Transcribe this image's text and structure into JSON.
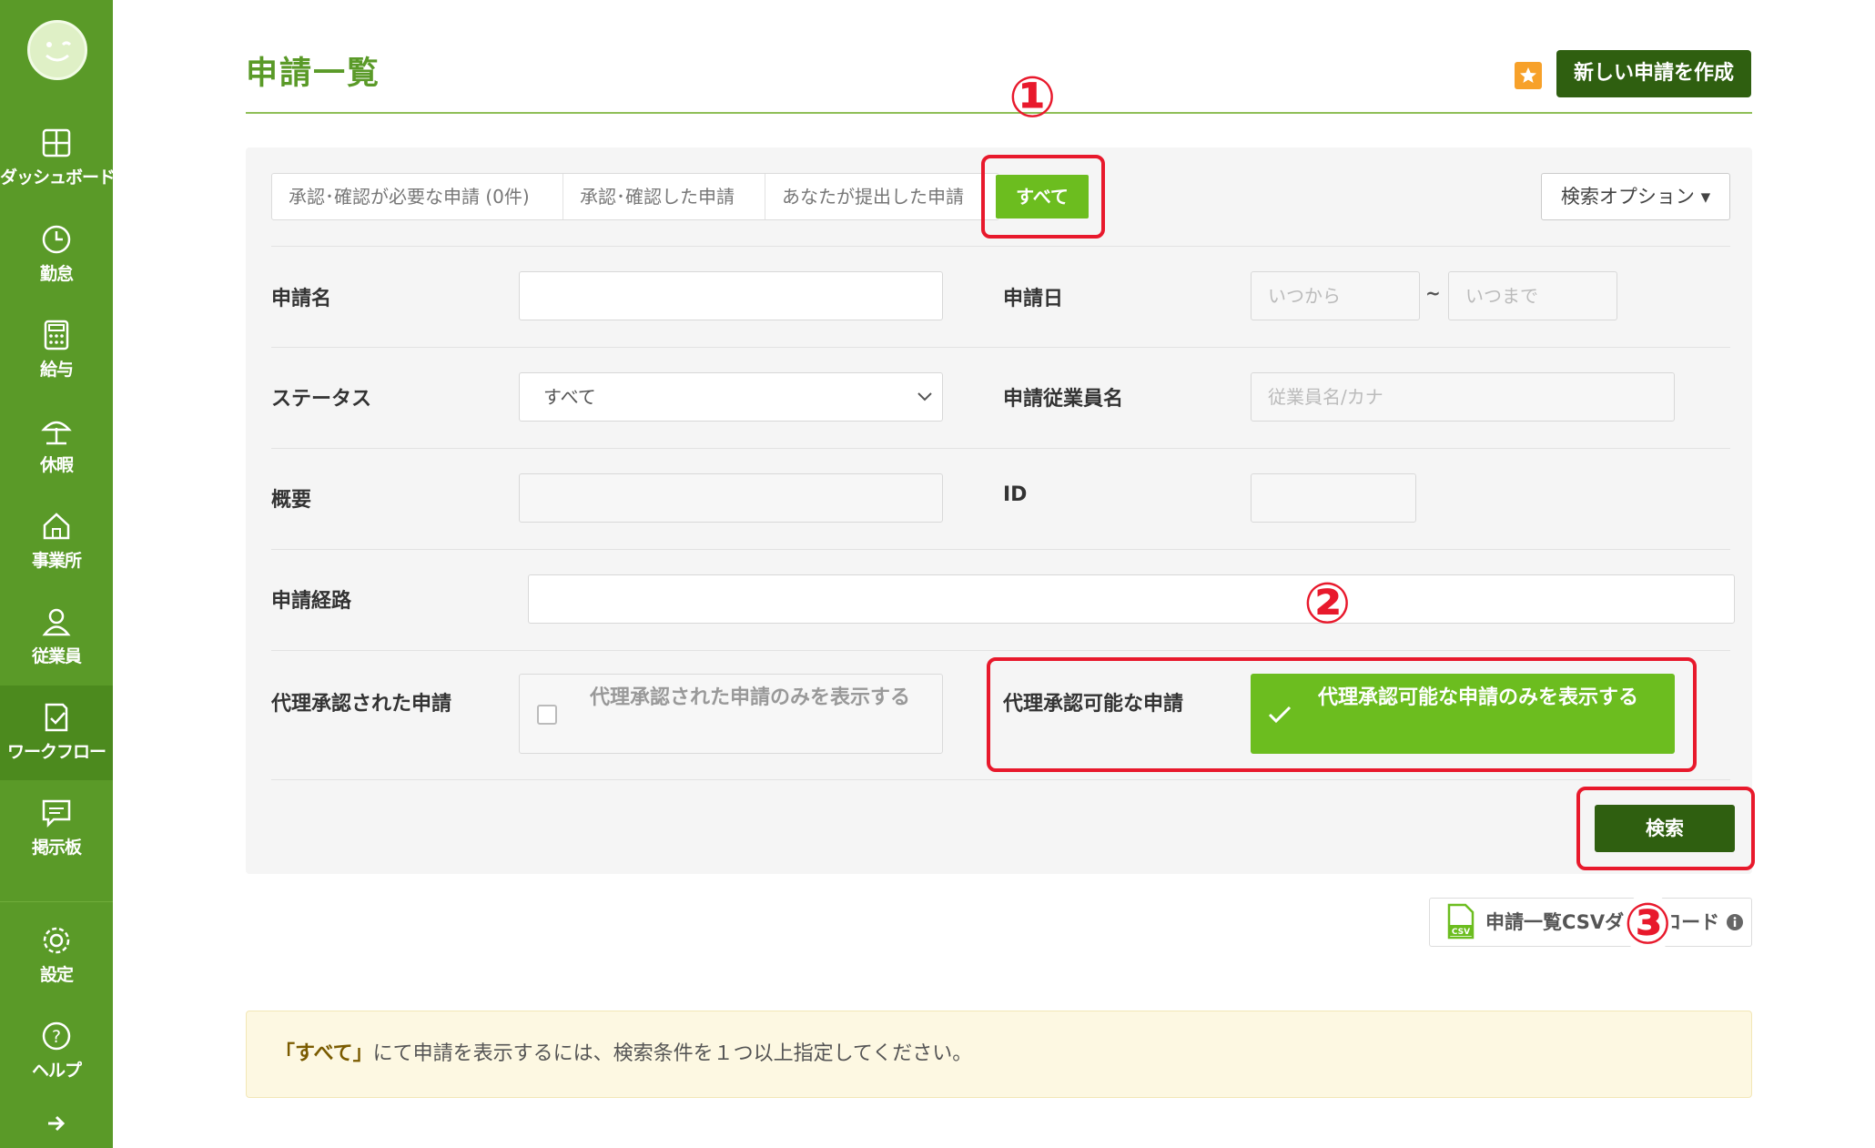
{
  "sidebar": {
    "items": [
      {
        "label": "ダッシュボード",
        "icon": "dashboard-icon"
      },
      {
        "label": "勤怠",
        "icon": "clock-icon"
      },
      {
        "label": "給与",
        "icon": "calculator-icon"
      },
      {
        "label": "休暇",
        "icon": "umbrella-icon"
      },
      {
        "label": "事業所",
        "icon": "home-icon"
      },
      {
        "label": "従業員",
        "icon": "person-icon"
      },
      {
        "label": "ワークフロー",
        "icon": "workflow-icon"
      },
      {
        "label": "掲示板",
        "icon": "chat-icon"
      },
      {
        "label": "設定",
        "icon": "gear-icon"
      },
      {
        "label": "ヘルプ",
        "icon": "help-icon"
      }
    ],
    "active": "ワークフロー",
    "color": "#5a9a28"
  },
  "header": {
    "title": "申請一覧",
    "new_button": "新しい申請を作成"
  },
  "tabs": {
    "items": [
      "承認･確認が必要な申請 (0件)",
      "承認･確認した申請",
      "あなたが提出した申請"
    ],
    "active": "すべて",
    "search_options": "検索オプション ▾"
  },
  "form": {
    "name_label": "申請名",
    "date_label": "申請日",
    "date_from_placeholder": "いつから",
    "date_sep": "~",
    "date_to_placeholder": "いつまで",
    "status_label": "ステータス",
    "status_value": "すべて",
    "employee_label": "申請従業員名",
    "employee_placeholder": "従業員名/カナ",
    "summary_label": "概要",
    "id_label": "ID",
    "route_label": "申請経路",
    "proxy_approved_label": "代理承認された申請",
    "proxy_approved_cb": "代理承認された申請のみを表示する",
    "proxy_approvable_label": "代理承認可能な申請",
    "proxy_approvable_cb": "代理承認可能な申請のみを表示する",
    "search_button": "検索"
  },
  "csv": {
    "label": "申請一覧CSVダウンロード"
  },
  "notice": {
    "bold": "「すべて」",
    "text": "にて申請を表示するには、検索条件を１つ以上指定してください。"
  },
  "annotations": [
    "①",
    "②",
    "③"
  ],
  "colors": {
    "accent": "#6cbd1f",
    "dark_button": "#2f5f10",
    "annotation": "#e8192c"
  }
}
